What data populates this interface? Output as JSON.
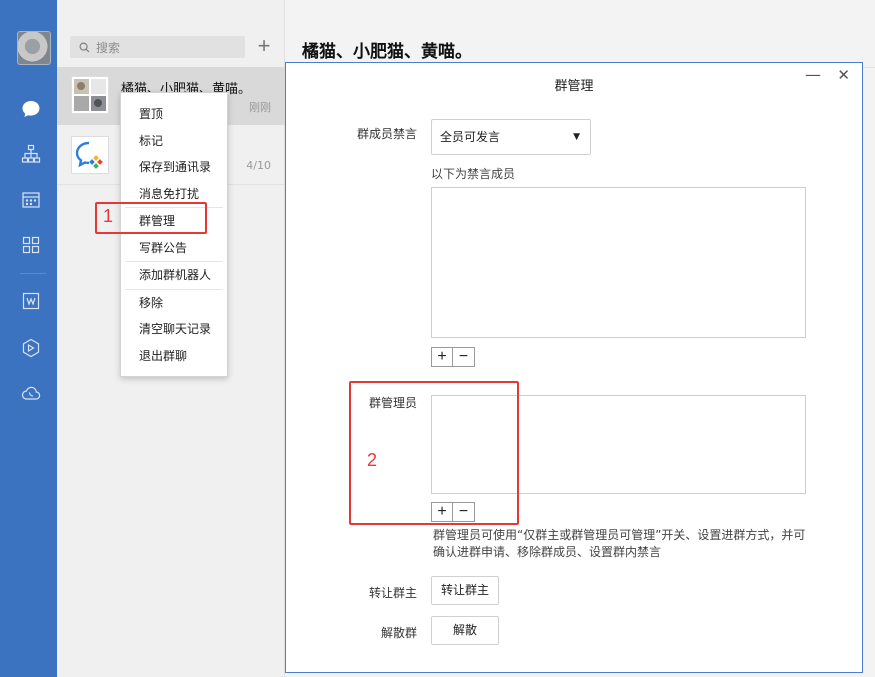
{
  "search": {
    "placeholder": "搜索"
  },
  "chat_list": [
    {
      "name": "橘猫、小肥猫、黄喵。",
      "time": "刚刚"
    },
    {
      "name": "",
      "time": "4/10"
    }
  ],
  "context_menu": {
    "items": [
      "置顶",
      "标记",
      "保存到通讯录",
      "消息免打扰",
      "群管理",
      "写群公告",
      "添加群机器人",
      "移除",
      "清空聊天记录",
      "退出群聊"
    ]
  },
  "chat_title": "橘猫、小肥猫、黄喵。",
  "dialog": {
    "title": "群管理",
    "mute_label": "群成员禁言",
    "mute_select": "全员可发言",
    "muted_members_note": "以下为禁言成员",
    "admins_label": "群管理员",
    "admins_desc": "群管理员可使用“仅群主或群管理员可管理”开关、设置进群方式，并可确认进群申请、移除群成员、设置群内禁言",
    "transfer_label": "转让群主",
    "transfer_button": "转让群主",
    "dissolve_label": "解散群",
    "dissolve_button": "解散",
    "plus": "+",
    "minus": "−",
    "minimize": "—",
    "close": "✕"
  },
  "annotations": {
    "one": "1",
    "two": "2"
  },
  "colors": {
    "rail": "#3c73c0",
    "highlight": "#e53935"
  }
}
